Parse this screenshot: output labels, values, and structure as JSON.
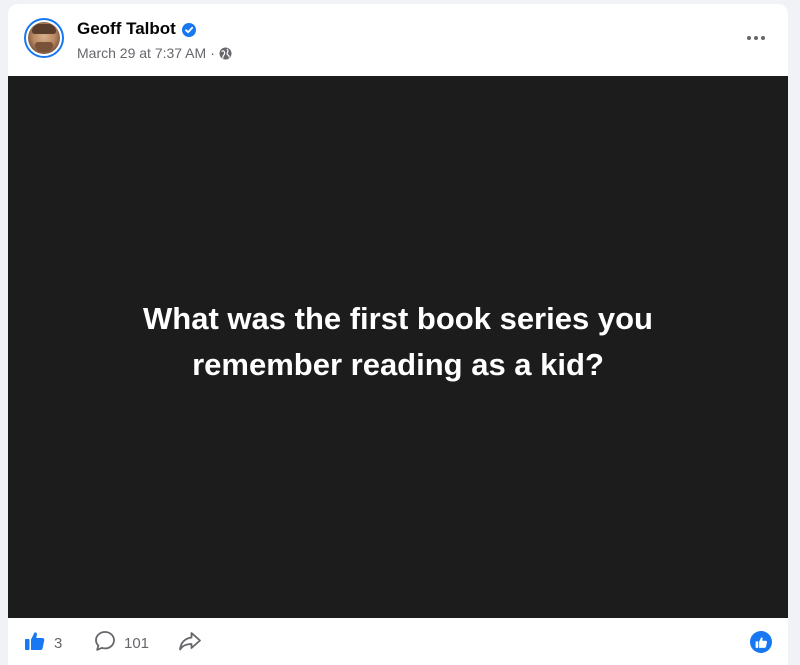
{
  "post": {
    "author_name": "Geoff Talbot",
    "timestamp": "March 29 at 7:37 AM",
    "separator": "·",
    "privacy_icon": "globe-icon",
    "more_icon": "more-options-icon",
    "text_line_1": "What was the first book series you",
    "text_line_2": "remember reading as a kid?",
    "background_color": "#1c1c1c"
  },
  "footer": {
    "like_icon": "thumbs-up-icon",
    "like_count": "3",
    "comment_icon": "comment-icon",
    "comment_count": "101",
    "share_icon": "share-icon",
    "reaction_icon": "like-reaction-icon"
  },
  "colors": {
    "accent": "#1877f2",
    "muted_text": "#65676b",
    "primary_text": "#050505"
  }
}
